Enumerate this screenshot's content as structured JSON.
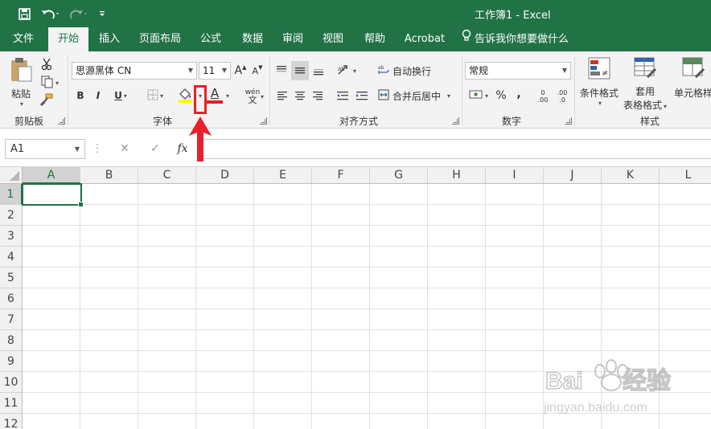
{
  "title_bar": {
    "title": "工作簿1  -  Excel",
    "quick_access": [
      "save-icon",
      "undo-icon",
      "redo-icon",
      "customize-icon"
    ]
  },
  "tabs": [
    {
      "label": "文件"
    },
    {
      "label": "开始",
      "active": true
    },
    {
      "label": "插入"
    },
    {
      "label": "页面布局"
    },
    {
      "label": "公式"
    },
    {
      "label": "数据"
    },
    {
      "label": "审阅"
    },
    {
      "label": "视图"
    },
    {
      "label": "帮助"
    },
    {
      "label": "Acrobat"
    },
    {
      "label": "告诉我你想要做什么"
    }
  ],
  "ribbon": {
    "clipboard": {
      "paste_label": "粘贴",
      "group_label": "剪贴板"
    },
    "font": {
      "font_name": "思源黑体 CN",
      "font_size": "11",
      "bold": "B",
      "italic": "I",
      "underline": "U",
      "increase_size": "A",
      "decrease_size": "A",
      "font_color_letter": "A",
      "phonetic_top": "wén",
      "phonetic_bottom": "文",
      "group_label": "字体"
    },
    "alignment": {
      "wrap_text": "自动换行",
      "merge_center": "合并后居中",
      "group_label": "对齐方式"
    },
    "number": {
      "format": "常规",
      "percent": "%",
      "comma": ",",
      "increase_decimal_top": "0",
      "increase_decimal_bottom": ".00",
      "decrease_decimal_top": ".00",
      "decrease_decimal_bottom": ".0",
      "group_label": "数字"
    },
    "styles": {
      "conditional_format": "条件格式",
      "table_format_1": "套用",
      "table_format_2": "表格格式",
      "cell_styles": "单元格样",
      "group_label": "样式"
    }
  },
  "formula_bar": {
    "name_box": "A1",
    "cancel": "✕",
    "enter": "✓",
    "function": "fx",
    "formula": ""
  },
  "sheet": {
    "columns": [
      "A",
      "B",
      "C",
      "D",
      "E",
      "F",
      "G",
      "H",
      "I",
      "J",
      "K",
      "L"
    ],
    "rows": [
      "1",
      "2",
      "3",
      "4",
      "5",
      "6",
      "7",
      "8",
      "9",
      "10",
      "11",
      "12"
    ],
    "active_cell": "A1"
  },
  "colors": {
    "excel_green": "#217346",
    "annotation_red": "#e8202a"
  },
  "watermark": {
    "brand": "Baidu经验",
    "url": "jingyan.baidu.com"
  }
}
